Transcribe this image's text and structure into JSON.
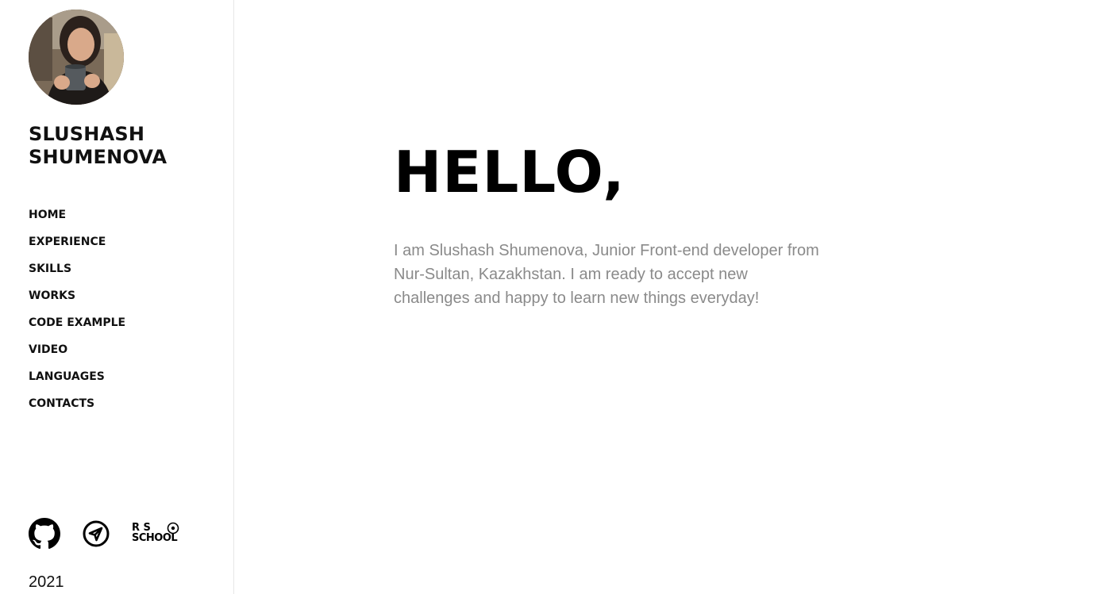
{
  "profile": {
    "first_name": "SLUSHASH",
    "last_name": "SHUMENOVA",
    "avatar_alt": "Portrait photo"
  },
  "nav": {
    "items": [
      {
        "label": "HOME"
      },
      {
        "label": "EXPERIENCE"
      },
      {
        "label": "SKILLS"
      },
      {
        "label": "WORKS"
      },
      {
        "label": "CODE EXAMPLE"
      },
      {
        "label": "VIDEO"
      },
      {
        "label": "LANGUAGES"
      },
      {
        "label": "CONTACTS"
      }
    ]
  },
  "socials": {
    "icons": [
      "github-icon",
      "telegram-icon",
      "rs-school-logo"
    ],
    "rs_logo_line1": "R  S",
    "rs_logo_line2": "SCHOOL"
  },
  "footer": {
    "year": "2021"
  },
  "hero": {
    "title": "HELLO,",
    "intro": "I am Slushash Shumenova, Junior Front-end developer from Nur-Sultan, Kazakhstan. I am ready to accept new challenges and happy to learn new things everyday!"
  },
  "colors": {
    "text": "#111111",
    "muted": "#8a8a8a",
    "divider": "#e6e6e6",
    "background": "#ffffff"
  }
}
